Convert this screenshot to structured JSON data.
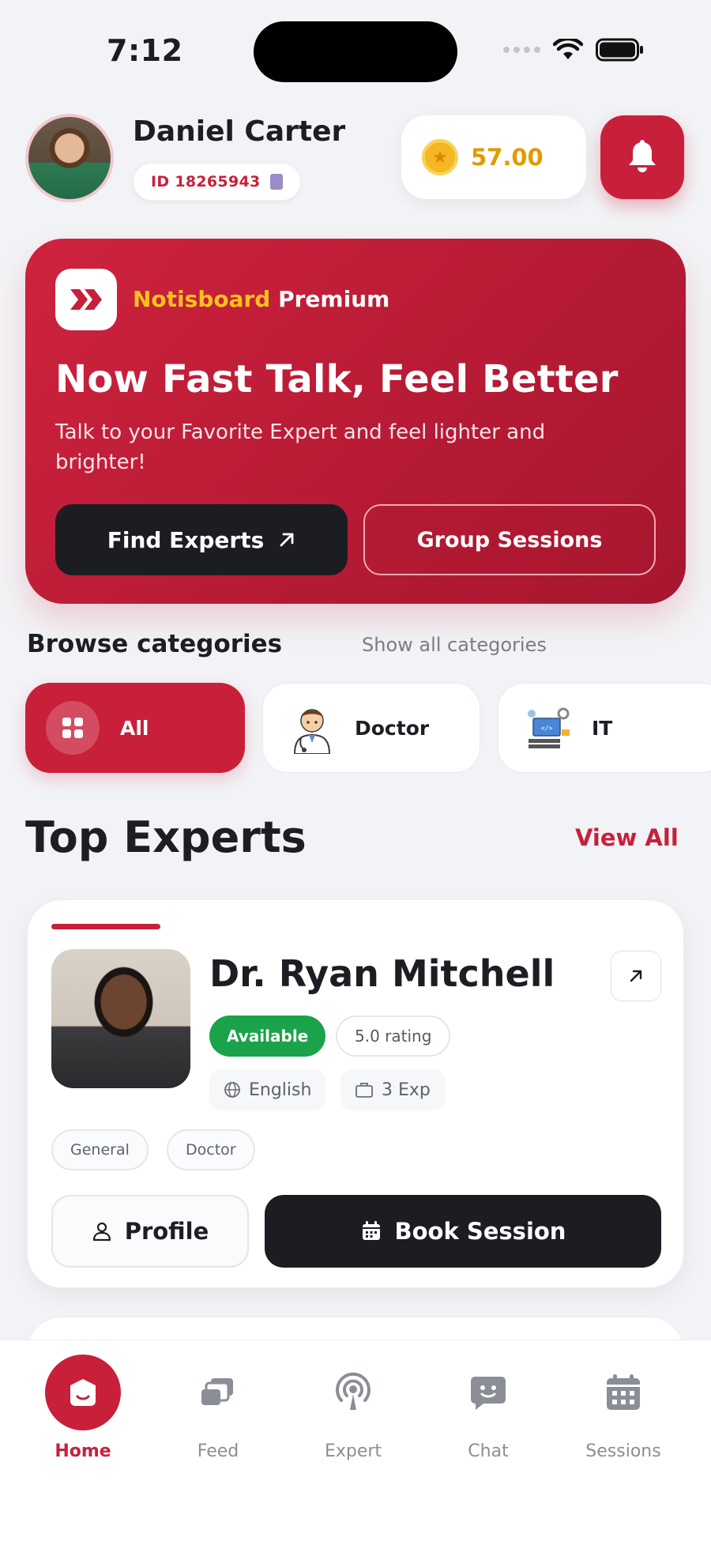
{
  "status_bar": {
    "time": "7:12"
  },
  "header": {
    "user_name": "Daniel Carter",
    "user_id": "ID 18265943",
    "coins": "57.00"
  },
  "hero": {
    "brand_part1": "Notisboard",
    "brand_part2": "Premium",
    "title": "Now Fast Talk, Feel Better",
    "subtitle": "Talk to your Favorite Expert and feel lighter and brighter!",
    "find_experts_label": "Find Experts",
    "group_sessions_label": "Group Sessions"
  },
  "categories": {
    "title": "Browse categories",
    "show_all": "Show all categories",
    "items": [
      {
        "label": "All",
        "icon": "grid-icon",
        "selected": true
      },
      {
        "label": "Doctor",
        "icon": "doctor-icon",
        "selected": false
      },
      {
        "label": "IT",
        "icon": "it-icon",
        "selected": false
      }
    ]
  },
  "top_experts": {
    "title": "Top Experts",
    "view_all": "View All",
    "cards": [
      {
        "name": "Dr. Ryan Mitchell",
        "availability": "Available",
        "rating": "5.0 rating",
        "language": "English",
        "experience": "3 Exp",
        "tags": [
          "General",
          "Doctor"
        ],
        "profile_label": "Profile",
        "book_label": "Book Session"
      }
    ]
  },
  "bottom_nav": {
    "items": [
      {
        "label": "Home",
        "icon": "home-icon",
        "active": true
      },
      {
        "label": "Feed",
        "icon": "feed-icon",
        "active": false
      },
      {
        "label": "Expert",
        "icon": "broadcast-icon",
        "active": false
      },
      {
        "label": "Chat",
        "icon": "chat-icon",
        "active": false
      },
      {
        "label": "Sessions",
        "icon": "calendar-icon",
        "active": false
      }
    ]
  },
  "colors": {
    "brand_red": "#c8203a",
    "dark": "#1c1d23",
    "coin_gold": "#e19a00",
    "available_green": "#1aa34a",
    "brand_yellow": "#f7c21c"
  }
}
